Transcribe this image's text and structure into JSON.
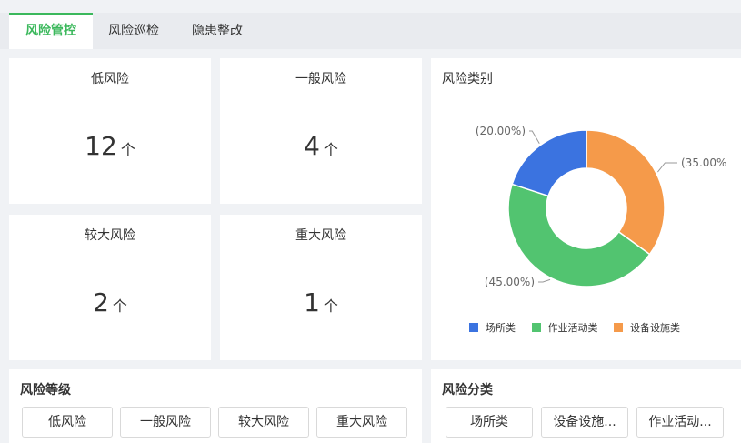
{
  "tabs": [
    {
      "label": "风险管控",
      "active": true
    },
    {
      "label": "风险巡检",
      "active": false
    },
    {
      "label": "隐患整改",
      "active": false
    }
  ],
  "stats": [
    {
      "title": "低风险",
      "value": "12",
      "unit": "个"
    },
    {
      "title": "一般风险",
      "value": "4",
      "unit": "个"
    },
    {
      "title": "较大风险",
      "value": "2",
      "unit": "个"
    },
    {
      "title": "重大风险",
      "value": "1",
      "unit": "个"
    }
  ],
  "category_panel": {
    "title": "风险类别"
  },
  "chart_data": {
    "type": "pie",
    "donut": true,
    "title": "风险类别",
    "slices": [
      {
        "name": "设备设施类",
        "value": 35.0,
        "label": "(35.00%",
        "color": "#f59a4a"
      },
      {
        "name": "作业活动类",
        "value": 45.0,
        "label": "(45.00%)",
        "color": "#52c470"
      },
      {
        "name": "场所类",
        "value": 20.0,
        "label": "(20.00%)",
        "color": "#3b73e0"
      }
    ],
    "legend": [
      "场所类",
      "作业活动类",
      "设备设施类"
    ],
    "legend_position": "bottom"
  },
  "level_panel": {
    "title": "风险等级",
    "buttons": [
      "低风险",
      "一般风险",
      "较大风险",
      "重大风险"
    ]
  },
  "class_panel": {
    "title": "风险分类",
    "buttons": [
      "场所类",
      "设备设施...",
      "作业活动..."
    ]
  },
  "colors": {
    "accent": "#3bb85c",
    "scene": "#3b73e0",
    "work": "#52c470",
    "equipment": "#f59a4a"
  }
}
